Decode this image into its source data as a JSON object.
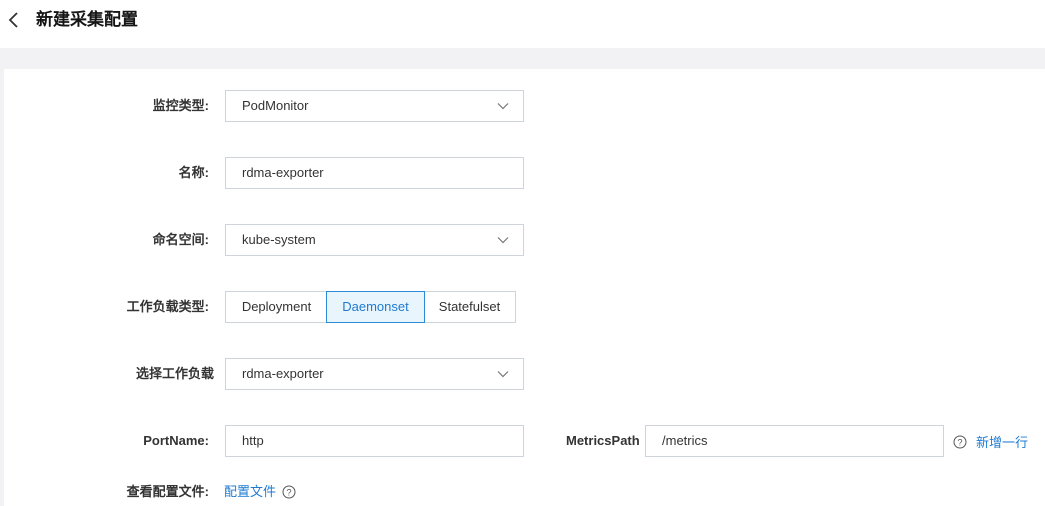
{
  "header": {
    "title": "新建采集配置"
  },
  "form": {
    "monitor_type": {
      "label": "监控类型:",
      "value": "PodMonitor"
    },
    "name": {
      "label": "名称:",
      "value": "rdma-exporter"
    },
    "namespace": {
      "label": "命名空间:",
      "value": "kube-system"
    },
    "workload_type": {
      "label": "工作负载类型:",
      "options": [
        "Deployment",
        "Daemonset",
        "Statefulset"
      ],
      "selected": "Daemonset"
    },
    "workload": {
      "label": "选择工作负载",
      "value": "rdma-exporter"
    },
    "port_name": {
      "label": "PortName:",
      "value": "http"
    },
    "metrics_path": {
      "label": "MetricsPath",
      "value": "/metrics"
    },
    "add_row": "新增一行",
    "config_file": {
      "label": "查看配置文件:",
      "link": "配置文件"
    }
  },
  "colors": {
    "accent": "#1f7bd1",
    "active_bg": "#e8f5fd",
    "border": "#cfd3da",
    "page_bg": "#f2f2f5"
  },
  "icons": [
    "back-arrow-icon",
    "chevron-down-icon",
    "help-circle-icon"
  ]
}
